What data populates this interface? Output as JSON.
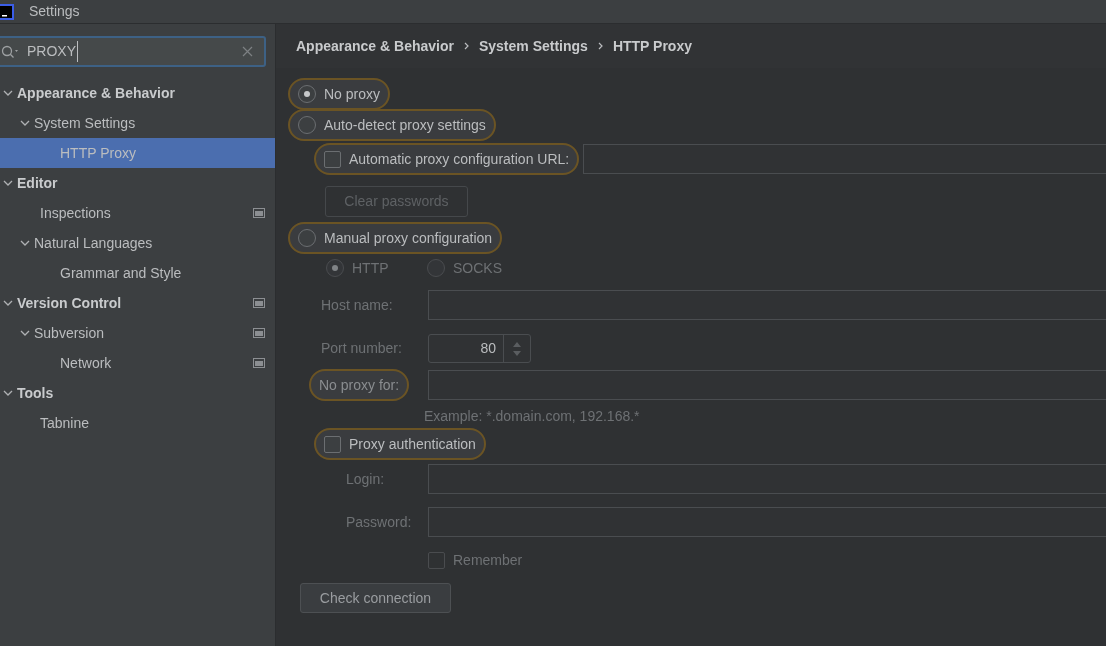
{
  "window": {
    "title": "Settings"
  },
  "search": {
    "value": "PROXY"
  },
  "tree": [
    {
      "label": "Appearance & Behavior",
      "selected": false,
      "expanded": true,
      "project_icon": false,
      "children": [
        {
          "label": "System Settings",
          "selected": false,
          "expanded": true,
          "project_icon": false,
          "children": [
            {
              "label": "HTTP Proxy",
              "selected": true,
              "project_icon": false
            }
          ]
        }
      ]
    },
    {
      "label": "Editor",
      "selected": false,
      "expanded": true,
      "project_icon": false,
      "children": [
        {
          "label": "Inspections",
          "selected": false,
          "project_icon": true
        },
        {
          "label": "Natural Languages",
          "selected": false,
          "expanded": true,
          "project_icon": false,
          "children": [
            {
              "label": "Grammar and Style",
              "selected": false,
              "project_icon": false
            }
          ]
        }
      ]
    },
    {
      "label": "Version Control",
      "selected": false,
      "expanded": true,
      "project_icon": true,
      "children": [
        {
          "label": "Subversion",
          "selected": false,
          "expanded": true,
          "project_icon": true,
          "children": [
            {
              "label": "Network",
              "selected": false,
              "project_icon": true
            }
          ]
        }
      ]
    },
    {
      "label": "Tools",
      "selected": false,
      "expanded": true,
      "project_icon": false,
      "children": [
        {
          "label": "Tabnine",
          "selected": false,
          "project_icon": false
        }
      ]
    }
  ],
  "breadcrumb": [
    "Appearance & Behavior",
    "System Settings",
    "HTTP Proxy"
  ],
  "no_proxy": {
    "label": "No proxy",
    "selected": true,
    "highlighted": true
  },
  "auto_detect": {
    "label": "Auto-detect proxy settings",
    "selected": false,
    "highlighted": true,
    "pac_url": {
      "label": "Automatic proxy configuration URL:",
      "checked": false,
      "highlighted": true
    },
    "clear_passwords": {
      "label": "Clear passwords",
      "disabled": true
    }
  },
  "manual": {
    "label": "Manual proxy configuration",
    "selected": false,
    "highlighted": true,
    "protocols": [
      {
        "label": "HTTP",
        "selected": true,
        "disabled": true
      },
      {
        "label": "SOCKS",
        "selected": false,
        "disabled": true
      }
    ],
    "host_name": {
      "label": "Host name:"
    },
    "port_number": {
      "label": "Port number:",
      "value": "80"
    },
    "no_proxy_for": {
      "label": "No proxy for:",
      "highlighted": true
    },
    "example": "Example: *.domain.com, 192.168.*",
    "proxy_auth": {
      "label": "Proxy authentication",
      "checked": false,
      "highlighted": true
    },
    "login": {
      "label": "Login:"
    },
    "password": {
      "label": "Password:"
    },
    "remember": {
      "label": "Remember",
      "checked": false,
      "disabled": true
    }
  },
  "check_connection": {
    "label": "Check connection"
  }
}
